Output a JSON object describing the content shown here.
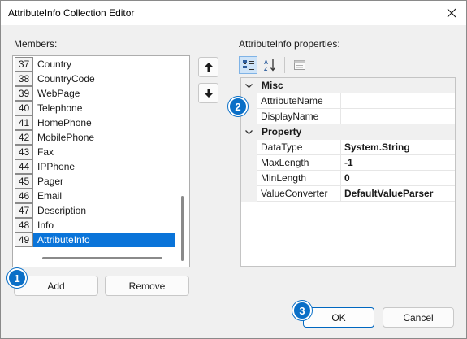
{
  "window": {
    "title": "AttributeInfo Collection Editor"
  },
  "members": {
    "label": "Members:",
    "items": [
      {
        "index": "37",
        "name": "Country"
      },
      {
        "index": "38",
        "name": "CountryCode"
      },
      {
        "index": "39",
        "name": "WebPage"
      },
      {
        "index": "40",
        "name": "Telephone"
      },
      {
        "index": "41",
        "name": "HomePhone"
      },
      {
        "index": "42",
        "name": "MobilePhone"
      },
      {
        "index": "43",
        "name": "Fax"
      },
      {
        "index": "44",
        "name": "IPPhone"
      },
      {
        "index": "45",
        "name": "Pager"
      },
      {
        "index": "46",
        "name": "Email"
      },
      {
        "index": "47",
        "name": "Description"
      },
      {
        "index": "48",
        "name": "Info"
      },
      {
        "index": "49",
        "name": "AttributeInfo"
      }
    ],
    "selected_index": "49"
  },
  "buttons": {
    "add": "Add",
    "remove": "Remove",
    "ok": "OK",
    "cancel": "Cancel"
  },
  "properties": {
    "label": "AttributeInfo properties:",
    "categories": [
      {
        "name": "Misc",
        "props": [
          {
            "name": "AttributeName",
            "value": ""
          },
          {
            "name": "DisplayName",
            "value": ""
          }
        ]
      },
      {
        "name": "Property",
        "props": [
          {
            "name": "DataType",
            "value": "System.String"
          },
          {
            "name": "MaxLength",
            "value": "-1"
          },
          {
            "name": "MinLength",
            "value": "0"
          },
          {
            "name": "ValueConverter",
            "value": "DefaultValueParser"
          }
        ]
      }
    ]
  },
  "callouts": [
    "1",
    "2",
    "3"
  ],
  "colors": {
    "selection": "#0a74d9",
    "callout": "#0a6fc7",
    "primary_border": "#0067c0"
  },
  "icons": {
    "close": "close-icon",
    "move_up": "arrow-up-icon",
    "move_down": "arrow-down-icon",
    "categorized": "categorized-icon",
    "alphabetical": "sort-alphabetical-icon",
    "property_pages": "property-pages-icon"
  }
}
